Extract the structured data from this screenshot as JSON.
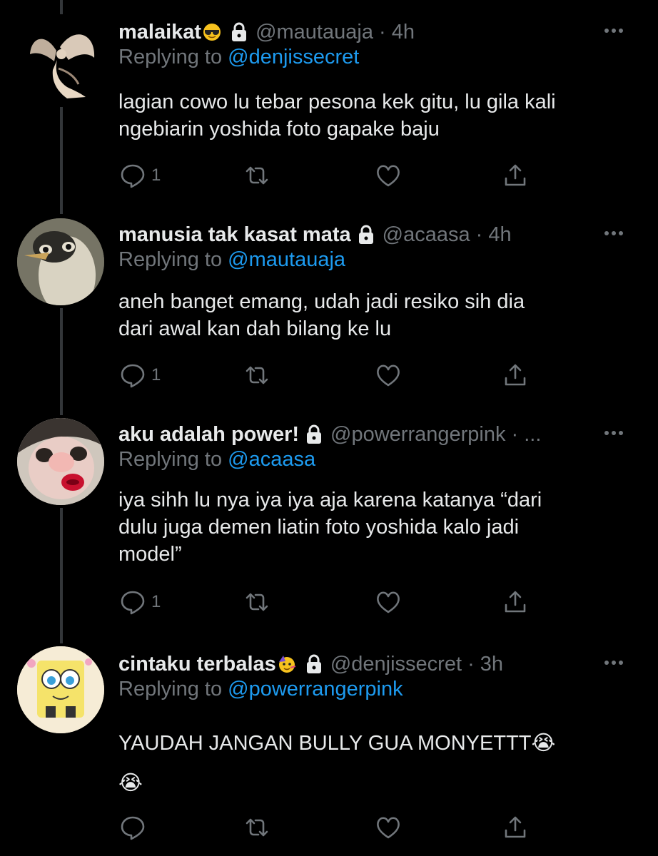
{
  "colors": {
    "background": "#000000",
    "text": "#e7e9ea",
    "muted": "#71767b",
    "mention": "#1d9bf0",
    "thread_line": "#333639"
  },
  "tweets": [
    {
      "name": "malaikat",
      "name_emoji": "😎",
      "handle_time": "@mautauaja · 4h",
      "replying_prefix": "Replying to",
      "replying_to": "@denjissecret",
      "text_lines": [
        "lagian cowo lu tebar pesona kek gitu, lu gila kali",
        "ngebiarin yoshida foto gapake baju"
      ],
      "reply_count": "1",
      "avatar_icon": "angel-statue-avatar"
    },
    {
      "name": "manusia tak kasat mata",
      "name_emoji": "",
      "handle_time": "@acaasa · 4h",
      "replying_prefix": "Replying to",
      "replying_to": "@mautauaja",
      "text_lines": [
        "aneh banget emang, udah jadi resiko sih dia",
        "dari awal kan dah bilang ke lu"
      ],
      "reply_count": "1",
      "avatar_icon": "penguin-avatar"
    },
    {
      "name": "aku adalah power!",
      "name_emoji": "",
      "handle_time": "@powerrangerpink · ...",
      "replying_prefix": "Replying to",
      "replying_to": "@acaasa",
      "text_lines": [
        "iya sihh lu nya iya iya aja karena katanya “dari",
        "dulu juga demen liatin foto yoshida kalo jadi",
        "model”"
      ],
      "reply_count": "1",
      "avatar_icon": "dog-face-avatar"
    },
    {
      "name": "cintaku terbalas",
      "name_emoji": "🥳",
      "handle_time": "@denjissecret · 3h",
      "replying_prefix": "Replying to",
      "replying_to": "@powerrangerpink",
      "text_lines": [
        "YAUDAH JANGAN BULLY GUA MONYETTT😭",
        "😭"
      ],
      "reply_count": "",
      "avatar_icon": "spongebob-avatar"
    }
  ]
}
